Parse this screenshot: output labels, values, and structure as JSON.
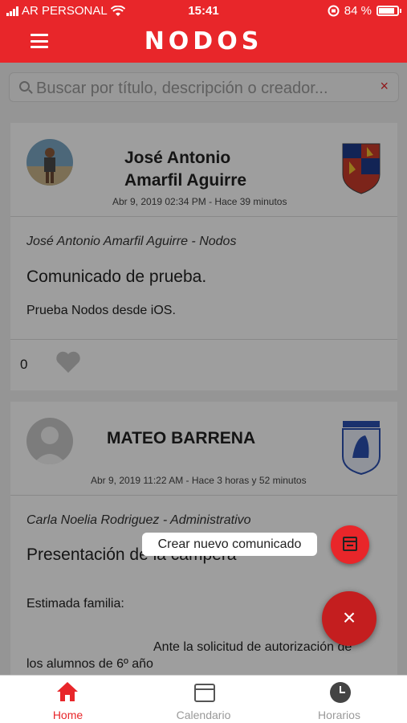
{
  "status": {
    "carrier": "AR PERSONAL",
    "time": "15:41",
    "battery": "84 %"
  },
  "header": {
    "title": "NODOS"
  },
  "search": {
    "placeholder": "Buscar por título, descripción o creador...",
    "clear_glyph": "×"
  },
  "posts": [
    {
      "author_line1": "José Antonio",
      "author_line2": "Amarfil Aguirre",
      "date": "Abr 9, 2019 02:34 PM - Hace 39 minutos",
      "from": "José Antonio Amarfil Aguirre - Nodos",
      "title": "Comunicado de prueba.",
      "body": "Prueba Nodos desde iOS.",
      "likes": "0"
    },
    {
      "author_line1": "MATEO BARRENA",
      "date": "Abr 9, 2019 11:22 AM - Hace 3 horas y 52 minutos",
      "from": "Carla Noelia Rodriguez - Administrativo",
      "title": "Presentación de la campera",
      "body1": "Estimada familia:",
      "body2": "Ante la solicitud de autorización de",
      "body3": "los alumnos de 6º año"
    }
  ],
  "fab": {
    "tooltip": "Crear nuevo comunicado",
    "close_glyph": "×"
  },
  "tabs": [
    {
      "label": "Home",
      "active": true
    },
    {
      "label": "Calendario"
    },
    {
      "label": "Horarios"
    }
  ],
  "colors": {
    "brand": "#e8262a",
    "fab_dark": "#c41e1f"
  }
}
